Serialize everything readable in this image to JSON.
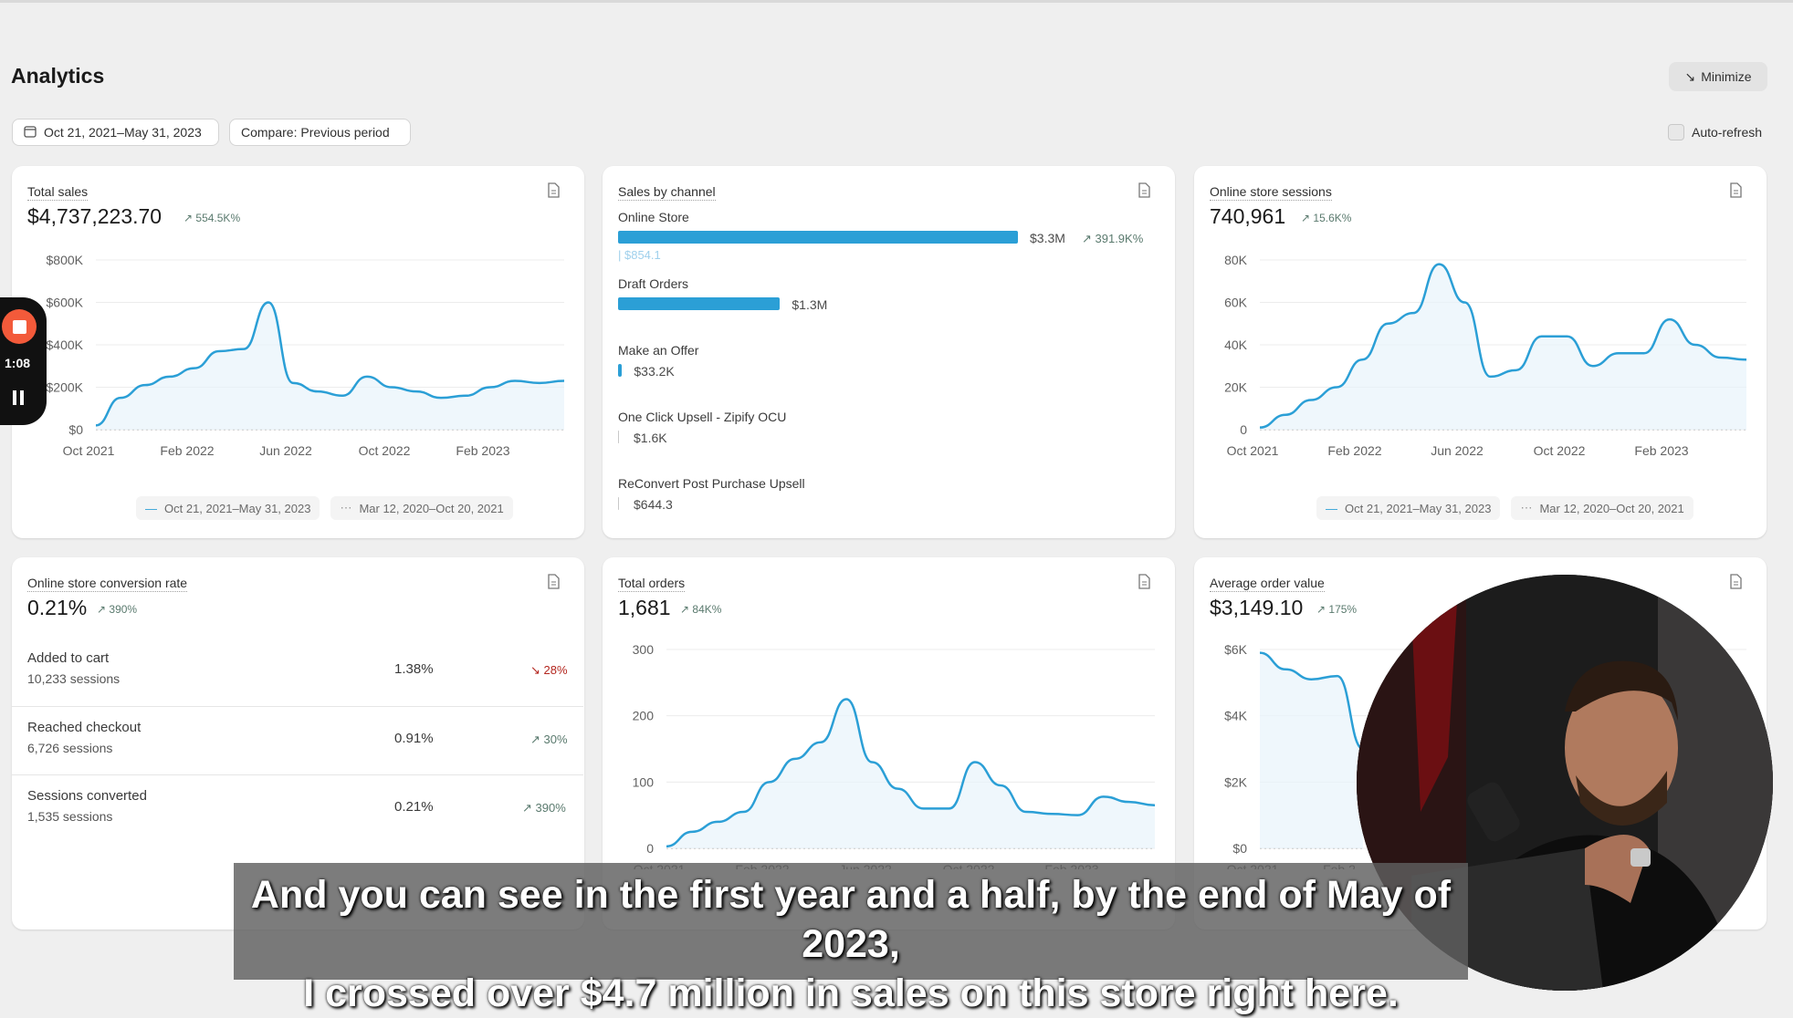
{
  "header": {
    "title": "Analytics",
    "minimize_label": "Minimize",
    "date_range": "Oct 21, 2021–May 31, 2023",
    "compare_label": "Compare: Previous period",
    "auto_refresh_label": "Auto-refresh"
  },
  "cards": {
    "total_sales": {
      "title": "Total sales",
      "value": "$4,737,223.70",
      "delta": "554.5K%",
      "y_ticks": [
        "$800K",
        "$600K",
        "$400K",
        "$200K",
        "$0"
      ],
      "x_ticks": [
        "Oct 2021",
        "Feb 2022",
        "Jun 2022",
        "Oct 2022",
        "Feb 2023"
      ],
      "legend_current": "Oct 21, 2021–May 31, 2023",
      "legend_previous": "Mar 12, 2020–Oct 20, 2021"
    },
    "sales_by_channel": {
      "title": "Sales by channel",
      "channels": [
        {
          "name": "Online Store",
          "value": "$3.3M",
          "delta": "391.9K%",
          "previous": "$854.1",
          "share": 1.0
        },
        {
          "name": "Draft Orders",
          "value": "$1.3M",
          "delta": "",
          "previous": "",
          "share": 0.405
        },
        {
          "name": "Make an Offer",
          "value": "$33.2K",
          "delta": "",
          "previous": "",
          "share": 0.01
        },
        {
          "name": "One Click Upsell - Zipify OCU",
          "value": "$1.6K",
          "delta": "",
          "previous": "",
          "share": 0.0005
        },
        {
          "name": "ReConvert Post Purchase Upsell",
          "value": "$644.3",
          "delta": "",
          "previous": "",
          "share": 0.0002
        }
      ]
    },
    "online_sessions": {
      "title": "Online store sessions",
      "value": "740,961",
      "delta": "15.6K%",
      "y_ticks": [
        "80K",
        "60K",
        "40K",
        "20K",
        "0"
      ],
      "x_ticks": [
        "Oct 2021",
        "Feb 2022",
        "Jun 2022",
        "Oct 2022",
        "Feb 2023"
      ],
      "legend_current": "Oct 21, 2021–May 31, 2023",
      "legend_previous": "Mar 12, 2020–Oct 20, 2021"
    },
    "conversion": {
      "title": "Online store conversion rate",
      "value": "0.21%",
      "delta": "390%",
      "rows": [
        {
          "label": "Added to cart",
          "sessions": "10,233 sessions",
          "pct": "1.38%",
          "delta": "28%",
          "dir": "down"
        },
        {
          "label": "Reached checkout",
          "sessions": "6,726 sessions",
          "pct": "0.91%",
          "delta": "30%",
          "dir": "up"
        },
        {
          "label": "Sessions converted",
          "sessions": "1,535 sessions",
          "pct": "0.21%",
          "delta": "390%",
          "dir": "up"
        }
      ]
    },
    "total_orders": {
      "title": "Total orders",
      "value": "1,681",
      "delta": "84K%",
      "y_ticks": [
        "300",
        "200",
        "100",
        "0"
      ],
      "x_ticks": [
        "Oct 2021",
        "Feb 2022",
        "Jun 2022",
        "Oct 2022",
        "Feb 2023"
      ]
    },
    "aov": {
      "title": "Average order value",
      "value": "$3,149.10",
      "delta": "175%",
      "y_ticks": [
        "$6K",
        "$4K",
        "$2K",
        "$0"
      ],
      "x_ticks": [
        "Oct 2021",
        "Feb 2"
      ]
    }
  },
  "recorder": {
    "time": "1:08"
  },
  "caption": {
    "line1": "And you can see in the first year and a half, by the end of May of 2023,",
    "line2": "I crossed over $4.7 million in sales on this store right here."
  },
  "colors": {
    "accent": "#2b9fd6",
    "record": "#f35a3a",
    "delta_up": "#5a7a6e",
    "delta_down": "#b3261e"
  },
  "chart_data": [
    {
      "type": "area",
      "title": "Total sales",
      "x": [
        "Oct 2021",
        "Nov 2021",
        "Dec 2021",
        "Jan 2022",
        "Feb 2022",
        "Mar 2022",
        "Apr 2022",
        "May 2022",
        "Jun 2022",
        "Jul 2022",
        "Aug 2022",
        "Sep 2022",
        "Oct 2022",
        "Nov 2022",
        "Dec 2022",
        "Jan 2023",
        "Feb 2023",
        "Mar 2023",
        "Apr 2023",
        "May 2023"
      ],
      "series": [
        {
          "name": "Oct 21, 2021–May 31, 2023",
          "values": [
            20,
            150,
            210,
            250,
            290,
            370,
            380,
            600,
            220,
            180,
            160,
            250,
            200,
            180,
            150,
            160,
            200,
            230,
            220,
            230
          ]
        }
      ],
      "ylim": [
        0,
        800000
      ],
      "y_unit": "thousands USD",
      "yticks": [
        "$800K",
        "$600K",
        "$400K",
        "$200K",
        "$0"
      ]
    },
    {
      "type": "bar",
      "title": "Sales by channel",
      "categories": [
        "Online Store",
        "Draft Orders",
        "Make an Offer",
        "One Click Upsell - Zipify OCU",
        "ReConvert Post Purchase Upsell"
      ],
      "values": [
        3300000,
        1300000,
        33200,
        1600,
        644.3
      ]
    },
    {
      "type": "area",
      "title": "Online store sessions",
      "x": [
        "Oct 2021",
        "Nov 2021",
        "Dec 2021",
        "Jan 2022",
        "Feb 2022",
        "Mar 2022",
        "Apr 2022",
        "May 2022",
        "Jun 2022",
        "Jul 2022",
        "Aug 2022",
        "Sep 2022",
        "Oct 2022",
        "Nov 2022",
        "Dec 2022",
        "Jan 2023",
        "Feb 2023",
        "Mar 2023",
        "Apr 2023",
        "May 2023"
      ],
      "series": [
        {
          "name": "Oct 21, 2021–May 31, 2023",
          "values": [
            1,
            7,
            14,
            20,
            33,
            50,
            55,
            78,
            60,
            25,
            28,
            44,
            44,
            30,
            36,
            36,
            52,
            40,
            34,
            33
          ]
        }
      ],
      "ylim": [
        0,
        80000
      ],
      "y_unit": "thousands",
      "yticks": [
        "80K",
        "60K",
        "40K",
        "20K",
        "0"
      ]
    },
    {
      "type": "area",
      "title": "Total orders",
      "x": [
        "Oct 2021",
        "Nov 2021",
        "Dec 2021",
        "Jan 2022",
        "Feb 2022",
        "Mar 2022",
        "Apr 2022",
        "May 2022",
        "Jun 2022",
        "Jul 2022",
        "Aug 2022",
        "Sep 2022",
        "Oct 2022",
        "Nov 2022",
        "Dec 2022",
        "Jan 2023",
        "Feb 2023",
        "Mar 2023",
        "Apr 2023",
        "May 2023"
      ],
      "series": [
        {
          "name": "Total orders",
          "values": [
            3,
            25,
            40,
            55,
            100,
            135,
            160,
            225,
            130,
            90,
            60,
            60,
            130,
            95,
            55,
            52,
            50,
            78,
            70,
            65
          ]
        }
      ],
      "ylim": [
        0,
        300
      ]
    },
    {
      "type": "line",
      "title": "Average order value",
      "x": [
        "Oct 2021",
        "Nov 2021",
        "Dec 2021",
        "Jan 2022",
        "Feb 2022"
      ],
      "series": [
        {
          "name": "Average order value",
          "values": [
            5900,
            5400,
            5100,
            5200,
            3000
          ]
        }
      ],
      "ylim": [
        0,
        6000
      ]
    }
  ]
}
